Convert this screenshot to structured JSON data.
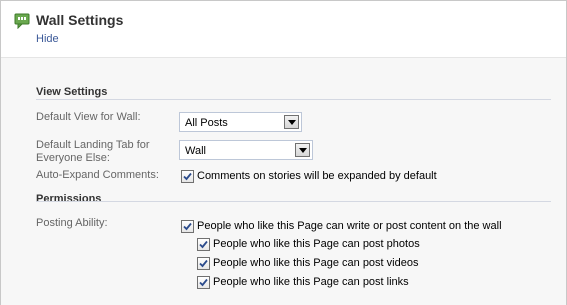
{
  "header": {
    "title": "Wall Settings",
    "hide_label": "Hide"
  },
  "view_settings": {
    "section_title": "View Settings",
    "default_view": {
      "label": "Default View for Wall:",
      "value": "All Posts"
    },
    "landing_tab": {
      "label_line1": "Default Landing Tab for",
      "label_line2": "Everyone Else:",
      "value": "Wall"
    },
    "auto_expand": {
      "label": "Auto-Expand Comments:",
      "checkbox_label": "Comments on stories will be expanded by default",
      "checked": true
    }
  },
  "permissions": {
    "section_title": "Permissions",
    "posting_ability": {
      "label": "Posting Ability:",
      "main": {
        "label": "People who like this Page can write or post content on the wall",
        "checked": true
      },
      "photos": {
        "label": "People who like this Page can post photos",
        "checked": true
      },
      "videos": {
        "label": "People who like this Page can post videos",
        "checked": true
      },
      "links": {
        "label": "People who like this Page can post links",
        "checked": true
      }
    }
  },
  "colors": {
    "link": "#3b5998",
    "panel_bg": "#f7f7f7",
    "icon_green": "#6aa84f"
  }
}
